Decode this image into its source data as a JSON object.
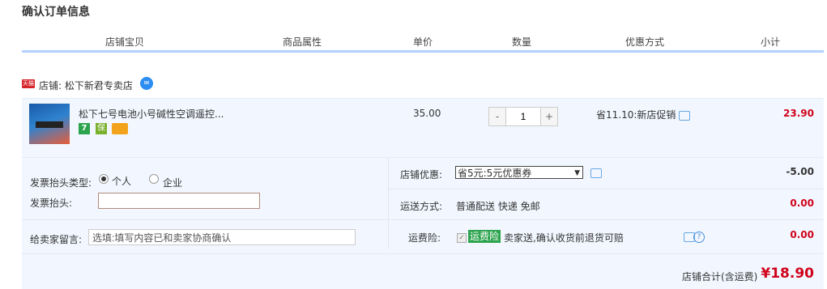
{
  "page_title": "确认订单信息",
  "columns": [
    "店铺宝贝",
    "商品属性",
    "单价",
    "数量",
    "优惠方式",
    "小计"
  ],
  "shop": {
    "badge": "天猫",
    "label": "店铺: 松下新君专卖店"
  },
  "item": {
    "title": "松下七号电池小号碱性空调遥控...",
    "tags": [
      "7",
      "保"
    ],
    "price": "35.00",
    "qty_minus": "-",
    "qty": "1",
    "qty_plus": "+",
    "promotion": "省11.10:新店促销",
    "subtotal": "23.90"
  },
  "invoice": {
    "type_label": "发票抬头类型:",
    "option_personal": "个人",
    "option_company": "企业",
    "title_label": "发票抬头:",
    "title_value": ""
  },
  "message": {
    "label": "给卖家留言:",
    "placeholder": "选填:填写内容已和卖家协商确认"
  },
  "shop_discount": {
    "label": "店铺优惠:",
    "selected": "省5元:5元优惠券",
    "amount": "-5.00"
  },
  "shipping": {
    "label": "运送方式:",
    "value": "普通配送 快递 免邮",
    "amount": "0.00"
  },
  "insurance": {
    "label": "运费险:",
    "badge": "运费险",
    "text": "卖家送,确认收货前退货可赔",
    "amount": "0.00"
  },
  "total": {
    "label": "店铺合计(含运费)",
    "value": "¥18.90"
  },
  "colors": {
    "accent_red": "#d0021b",
    "header_border": "#b2d1ff",
    "row_bg": "#f2f7ff",
    "badge_green": "#2ca34d"
  }
}
